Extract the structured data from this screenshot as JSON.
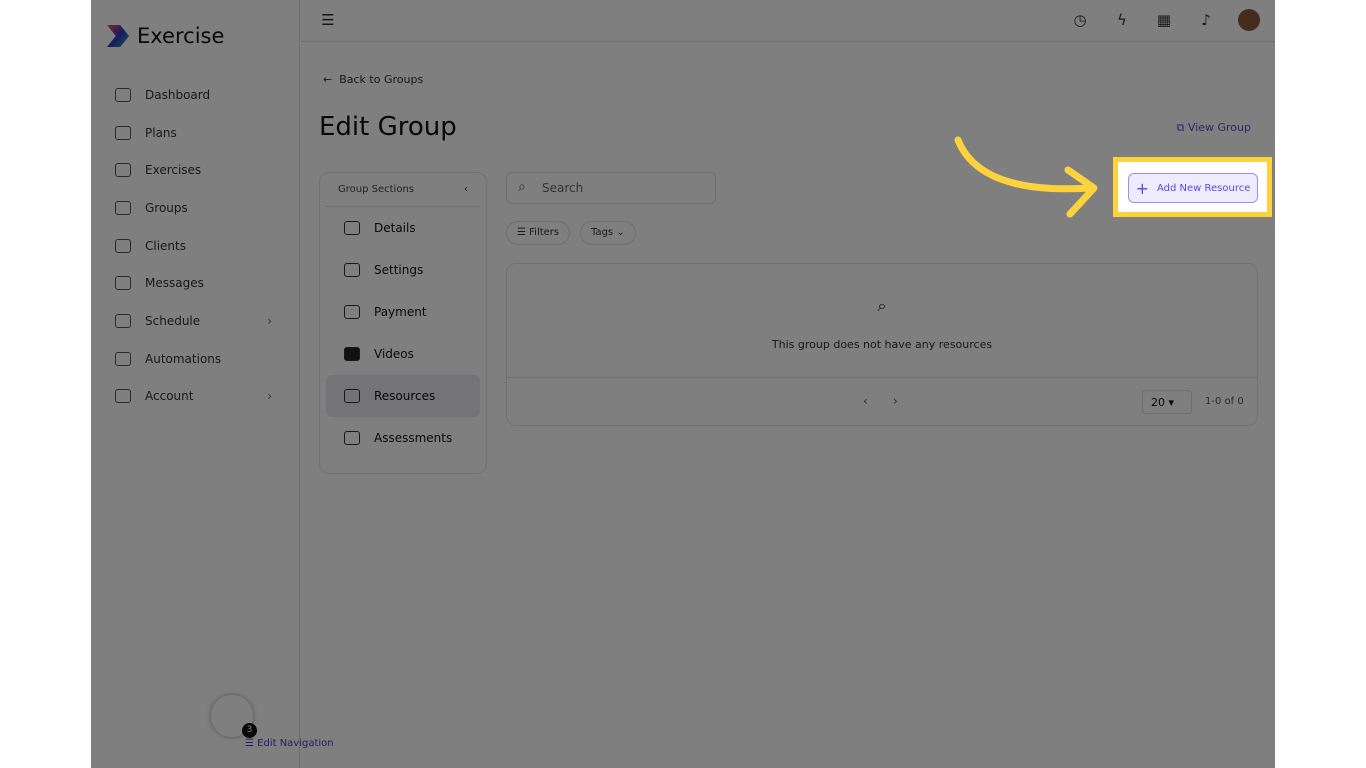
{
  "app": {
    "name": "Exercise"
  },
  "sidebar": {
    "items": [
      {
        "label": "Dashboard"
      },
      {
        "label": "Plans"
      },
      {
        "label": "Exercises"
      },
      {
        "label": "Groups"
      },
      {
        "label": "Clients"
      },
      {
        "label": "Messages"
      },
      {
        "label": "Schedule",
        "chevron": true
      },
      {
        "label": "Automations"
      },
      {
        "label": "Account",
        "chevron": true
      }
    ],
    "badge": "3",
    "edit_nav": "Edit Navigation"
  },
  "main": {
    "back": "Back to Groups",
    "title": "Edit Group",
    "view_group": "View Group",
    "add_resource": "Add New Resource",
    "sections": {
      "title": "Group Sections",
      "items": [
        "Details",
        "Settings",
        "Payment",
        "Videos",
        "Resources",
        "Assessments"
      ],
      "active": "Resources"
    },
    "search_placeholder": "Search",
    "filters": "Filters",
    "tags": "Tags",
    "empty": "This group does not have any resources",
    "page_size": "20",
    "range": "1-0 of 0"
  },
  "colors": {
    "accent": "#5a4bd8",
    "highlight": "#fdd33d"
  }
}
